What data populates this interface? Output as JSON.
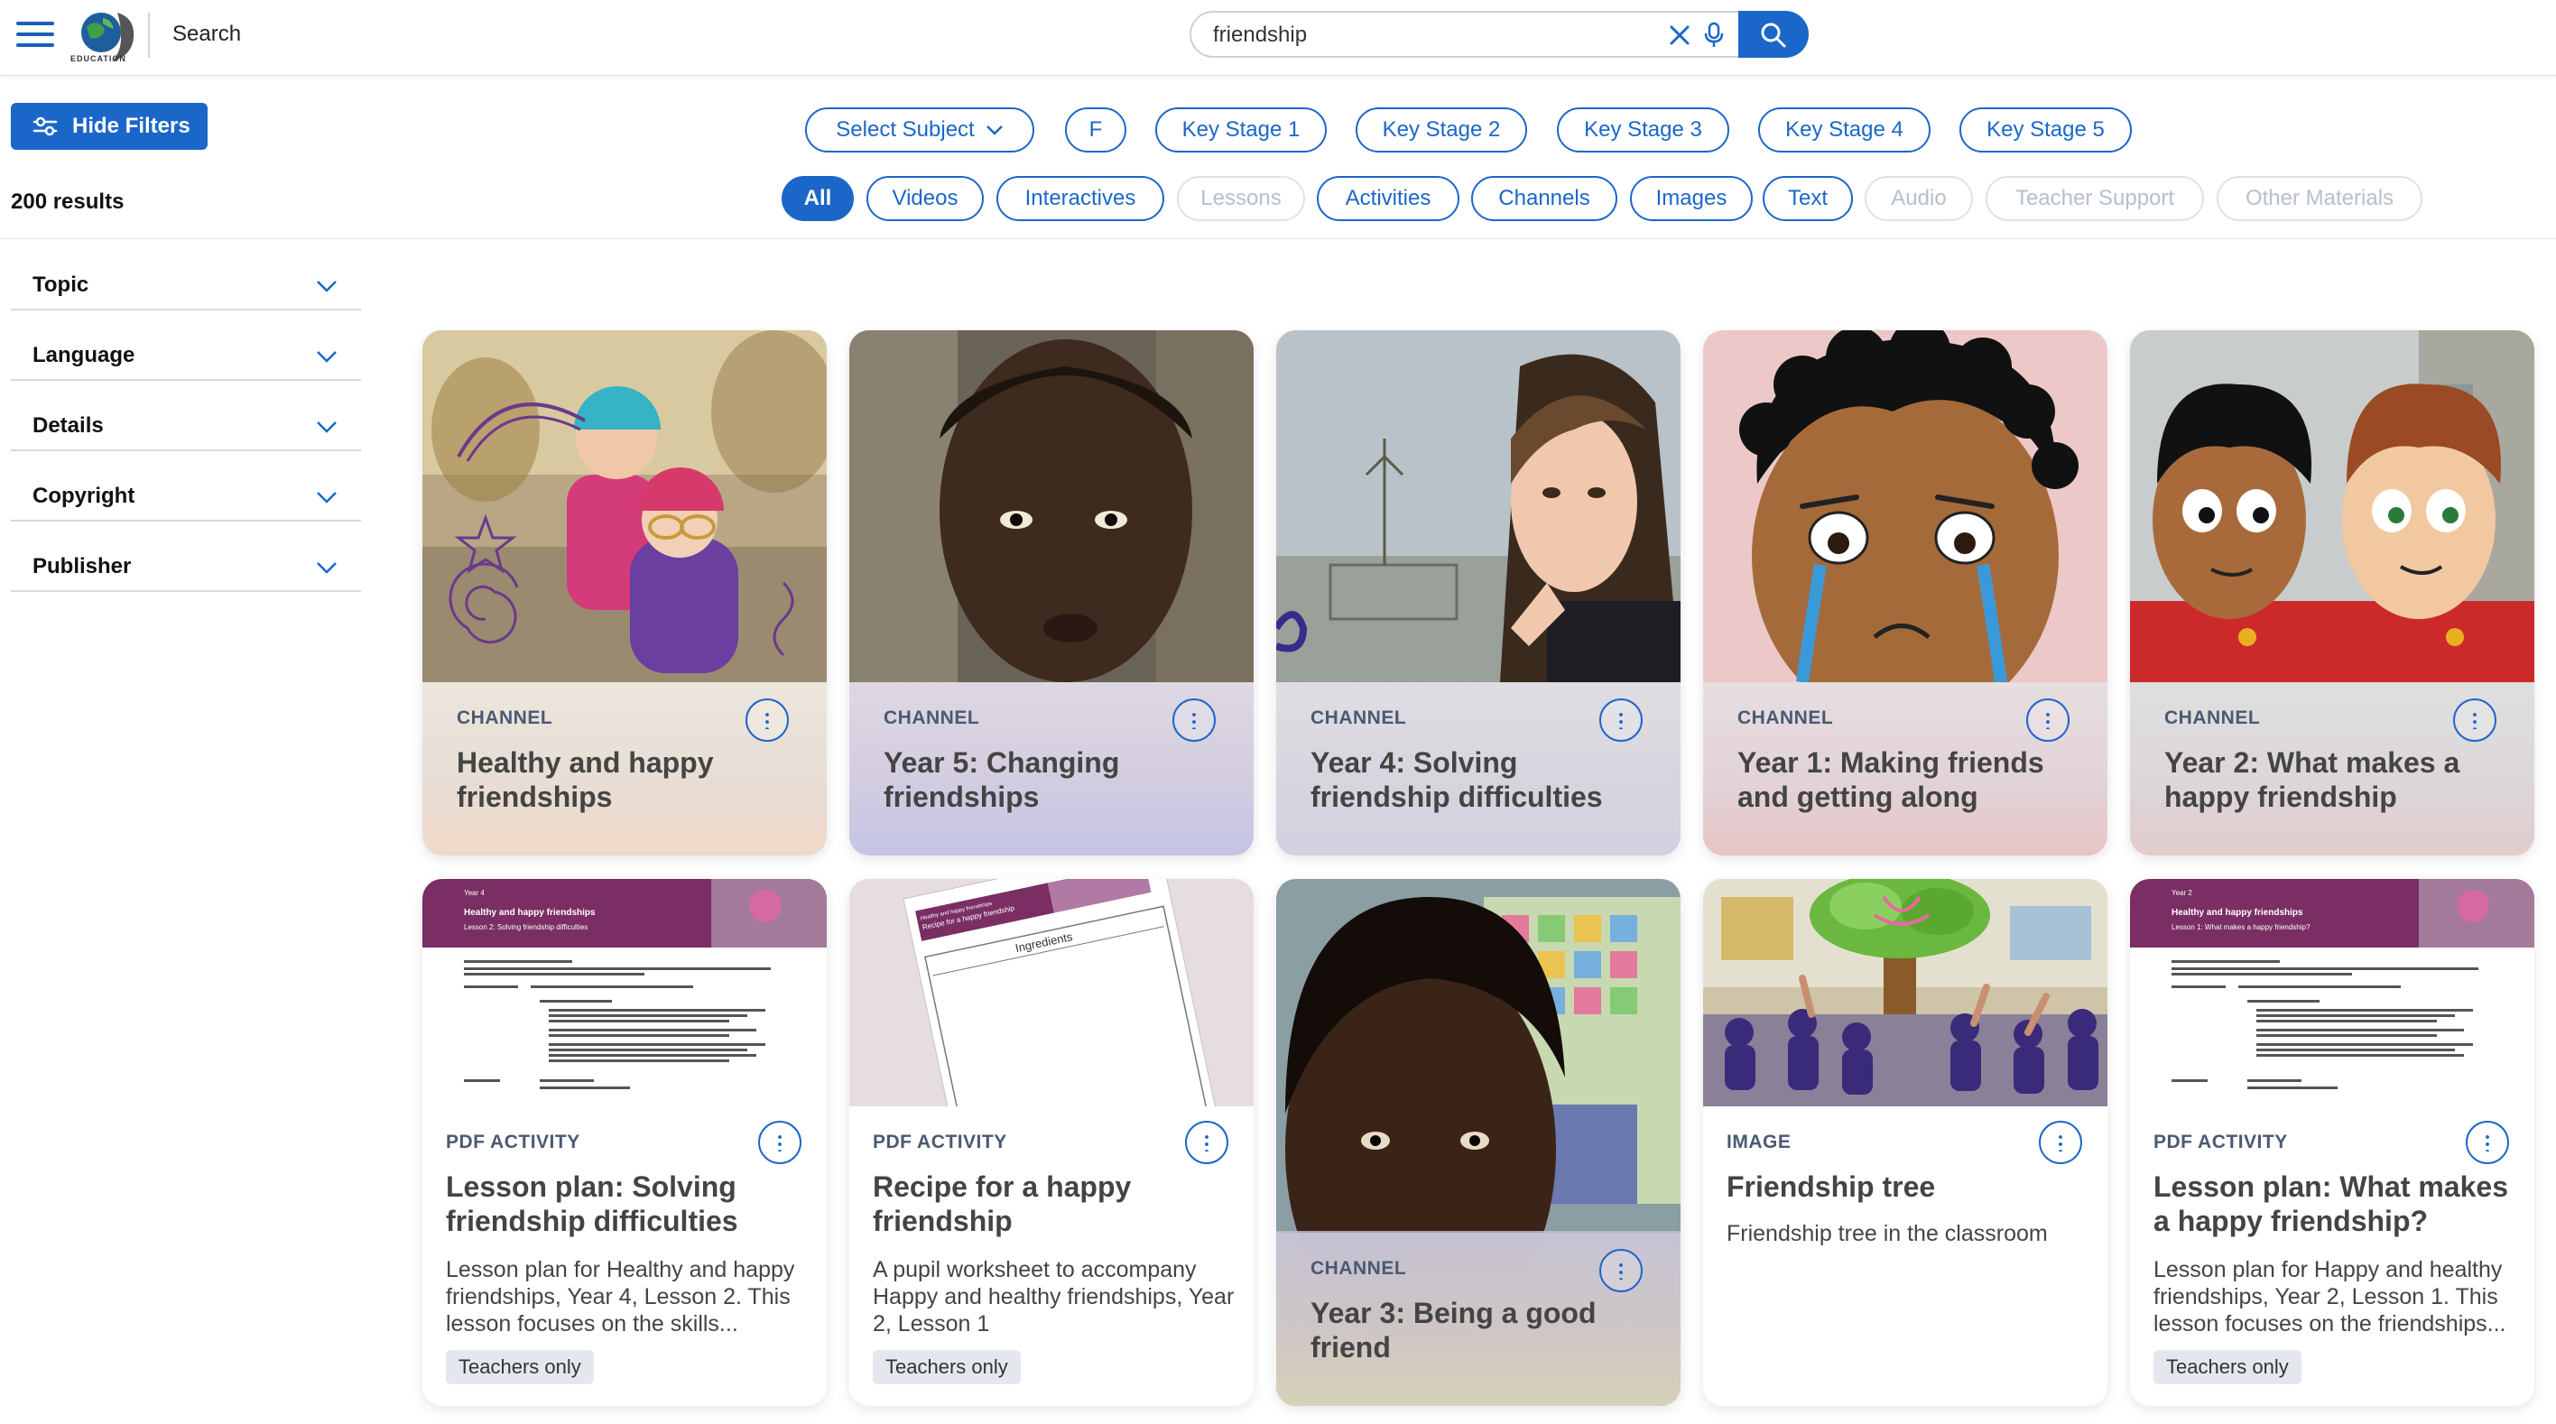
{
  "header": {
    "logo_text": "EDUCATION",
    "section_label": "Search",
    "search_value": "friendship"
  },
  "toolbar": {
    "hide_filters_label": "Hide Filters",
    "results_count": "200 results",
    "subject_select": "Select Subject",
    "stages": [
      "F",
      "Key Stage 1",
      "Key Stage 2",
      "Key Stage 3",
      "Key Stage 4",
      "Key Stage 5"
    ],
    "types": [
      {
        "label": "All",
        "state": "active"
      },
      {
        "label": "Videos",
        "state": "enabled"
      },
      {
        "label": "Interactives",
        "state": "enabled"
      },
      {
        "label": "Lessons",
        "state": "disabled"
      },
      {
        "label": "Activities",
        "state": "enabled"
      },
      {
        "label": "Channels",
        "state": "enabled"
      },
      {
        "label": "Images",
        "state": "enabled"
      },
      {
        "label": "Text",
        "state": "enabled"
      },
      {
        "label": "Audio",
        "state": "disabled"
      },
      {
        "label": "Teacher Support",
        "state": "disabled"
      },
      {
        "label": "Other Materials",
        "state": "disabled"
      }
    ]
  },
  "facets": [
    "Topic",
    "Language",
    "Details",
    "Copyright",
    "Publisher"
  ],
  "cards": [
    {
      "type": "CHANNEL",
      "title": "Healthy and happy friendships"
    },
    {
      "type": "CHANNEL",
      "title": "Year 5: Changing friendships"
    },
    {
      "type": "CHANNEL",
      "title": "Year 4: Solving friendship difficulties"
    },
    {
      "type": "CHANNEL",
      "title": "Year 1: Making friends and getting along"
    },
    {
      "type": "CHANNEL",
      "title": "Year 2: What makes a happy friendship"
    },
    {
      "type": "PDF ACTIVITY",
      "title": "Lesson plan: Solving friendship difficulties",
      "desc": "Lesson plan for Healthy and happy friendships, Year 4, Lesson 2. This lesson focuses on the skills...",
      "badge": "Teachers only"
    },
    {
      "type": "PDF ACTIVITY",
      "title": "Recipe for a happy friendship",
      "desc": "A pupil worksheet to accompany Happy and healthy friendships, Year 2, Lesson 1",
      "badge": "Teachers only"
    },
    {
      "type": "CHANNEL",
      "title": "Year 3: Being a good friend"
    },
    {
      "type": "IMAGE",
      "title": "Friendship tree",
      "desc": "Friendship tree in the classroom"
    },
    {
      "type": "PDF ACTIVITY",
      "title": "Lesson plan: What makes a happy friendship?",
      "desc": "Lesson plan for Happy and healthy friendships, Year 2, Lesson 1. This lesson focuses on the friendships...",
      "badge": "Teachers only"
    }
  ],
  "doc_thumbs": {
    "lp1": {
      "year": "Year 4",
      "title": "Healthy and happy friendships",
      "sub": "Lesson 2: Solving friendship difficulties"
    },
    "lp2": {
      "year": "Year 2",
      "title": "Healthy and happy friendships",
      "sub": "Lesson 1: What makes a happy friendship?"
    },
    "worksheet": {
      "header": "Healthy and happy friendships",
      "title": "Recipe for a happy friendship",
      "label": "Ingredients"
    }
  },
  "colors": {
    "accent": "#1b67c9",
    "doc_purple": "#7a2e63"
  }
}
